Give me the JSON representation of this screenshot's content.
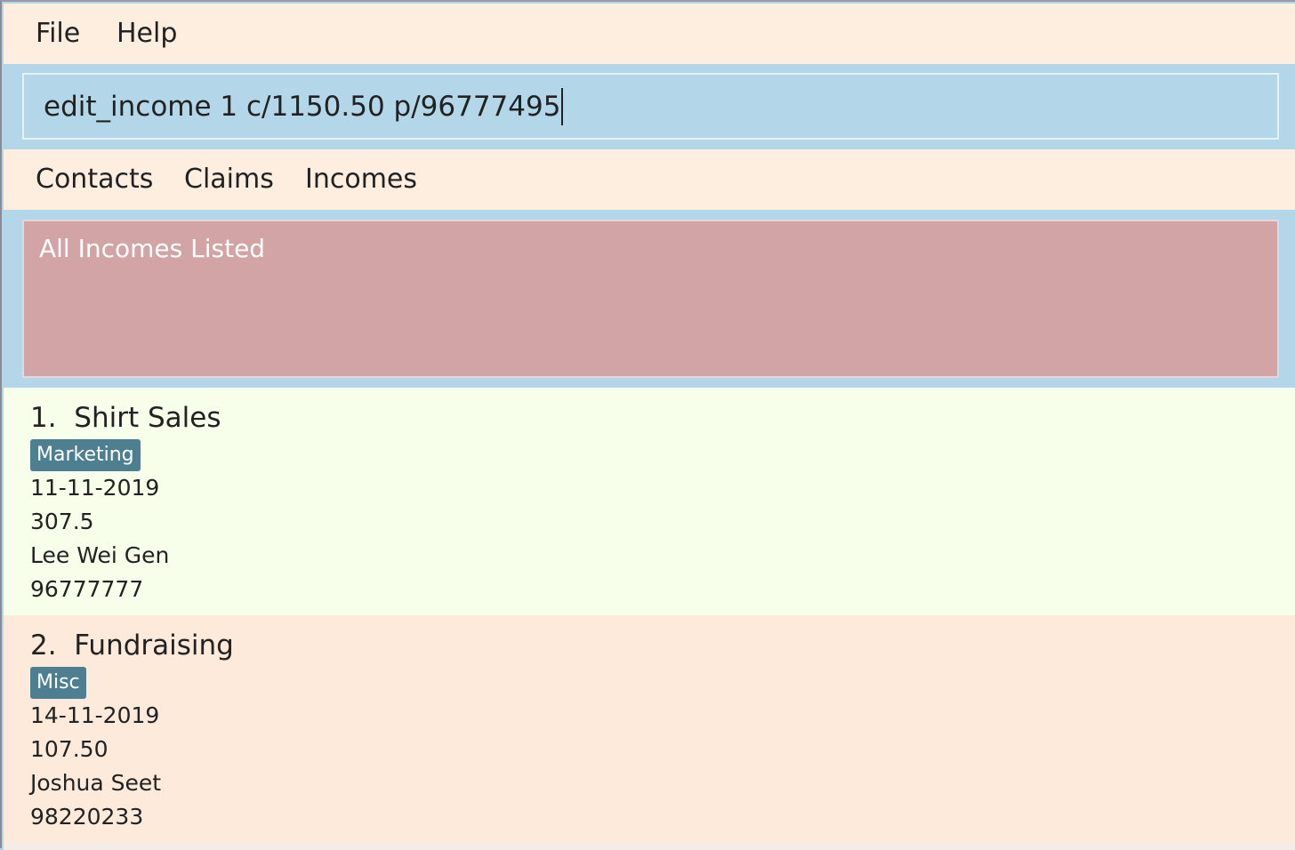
{
  "menubar": {
    "items": [
      {
        "label": "File"
      },
      {
        "label": "Help"
      }
    ]
  },
  "command": {
    "value": "edit_income 1 c/1150.50 p/96777495"
  },
  "tabs": [
    {
      "label": "Contacts"
    },
    {
      "label": "Claims"
    },
    {
      "label": "Incomes"
    }
  ],
  "result": {
    "message": "All Incomes Listed"
  },
  "incomes": [
    {
      "index": "1.",
      "title": "Shirt Sales",
      "tag": "Marketing",
      "date": "11-11-2019",
      "amount": "307.5",
      "name": "Lee Wei Gen",
      "phone": "96777777"
    },
    {
      "index": "2.",
      "title": "Fundraising",
      "tag": "Misc",
      "date": "14-11-2019",
      "amount": "107.50",
      "name": "Joshua Seet",
      "phone": "98220233"
    }
  ],
  "colors": {
    "menu_bg": "#feeee0",
    "command_bg": "#b3d7e8",
    "result_bg": "#d3a4a5",
    "card_odd_bg": "#f7fee9",
    "card_even_bg": "#feeadb",
    "tag_bg": "#4e7f91"
  }
}
